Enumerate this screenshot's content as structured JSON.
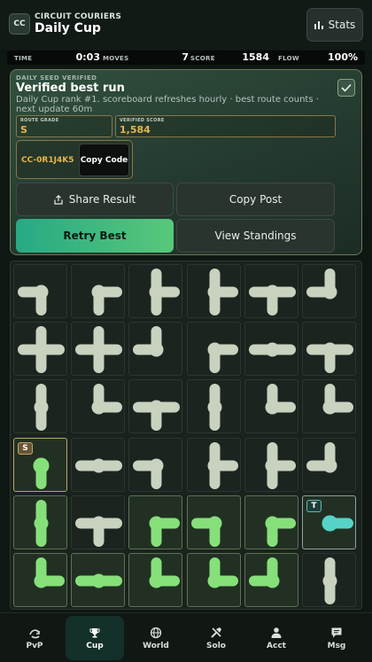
{
  "header": {
    "logo_text": "CC",
    "app_name": "CIRCUIT COURIERS",
    "mode_title": "Daily Cup",
    "stats_label": "Stats",
    "stats_icon": "bar-chart-icon"
  },
  "statbar": {
    "time_label": "TIME",
    "time_value": "0:03",
    "moves_label": "MOVES",
    "moves_value": "7",
    "score_label": "SCORE",
    "score_value": "1584",
    "flow_label": "FLOW",
    "flow_value": "100%"
  },
  "result": {
    "seed_tag": "DAILY SEED VERIFIED",
    "title": "Verified best run",
    "description": "Daily Cup rank #1. scoreboard refreshes hourly · best route counts · next update 60m",
    "route_grade_label": "ROUTE GRADE",
    "route_grade_value": "S",
    "verified_score_label": "VERIFIED SCORE",
    "verified_score_value": "1,584",
    "code": "CC-0R1J4K5",
    "copy_code_label": "Copy Code",
    "share_label": "Share Result",
    "copy_post_label": "Copy Post",
    "retry_label": "Retry Best",
    "standings_label": "View Standings"
  },
  "board": {
    "rows": 6,
    "cols": 6,
    "source_badge": "S",
    "target_badge": "T",
    "colors": {
      "inactive_pipe": "#c8d2bf",
      "flow_pipe": "#86e07a",
      "target_pipe": "#56d3c8"
    },
    "cells": [
      [
        "LD",
        "RD",
        "URD",
        "URD",
        "LRD",
        "LU"
      ],
      [
        "URDL",
        "URDL",
        "LU",
        "RD",
        "LR",
        "LRD"
      ],
      [
        "UD",
        "UR",
        "LRD",
        "UD",
        "UR",
        "UR"
      ],
      [
        "D",
        "LR",
        "LD",
        "URD",
        "URD",
        "LU"
      ],
      [
        "UD",
        "LRD",
        "RD",
        "LD",
        "RD",
        "R"
      ],
      [
        "UR",
        "LR",
        "RU",
        "UR",
        "LU",
        "UD"
      ]
    ],
    "flow": [
      [
        false,
        false,
        false,
        false,
        false,
        false
      ],
      [
        false,
        false,
        false,
        false,
        false,
        false
      ],
      [
        false,
        false,
        false,
        false,
        false,
        false
      ],
      [
        true,
        false,
        false,
        false,
        false,
        false
      ],
      [
        true,
        false,
        true,
        true,
        true,
        true
      ],
      [
        true,
        true,
        true,
        true,
        true,
        false
      ]
    ]
  },
  "nav": {
    "items": [
      {
        "label": "PvP",
        "icon": "pvp-icon",
        "active": false
      },
      {
        "label": "Cup",
        "icon": "trophy-icon",
        "active": true
      },
      {
        "label": "World",
        "icon": "globe-icon",
        "active": false
      },
      {
        "label": "Solo",
        "icon": "tools-icon",
        "active": false
      },
      {
        "label": "Acct",
        "icon": "person-icon",
        "active": false
      },
      {
        "label": "Msg",
        "icon": "message-icon",
        "active": false
      }
    ]
  }
}
